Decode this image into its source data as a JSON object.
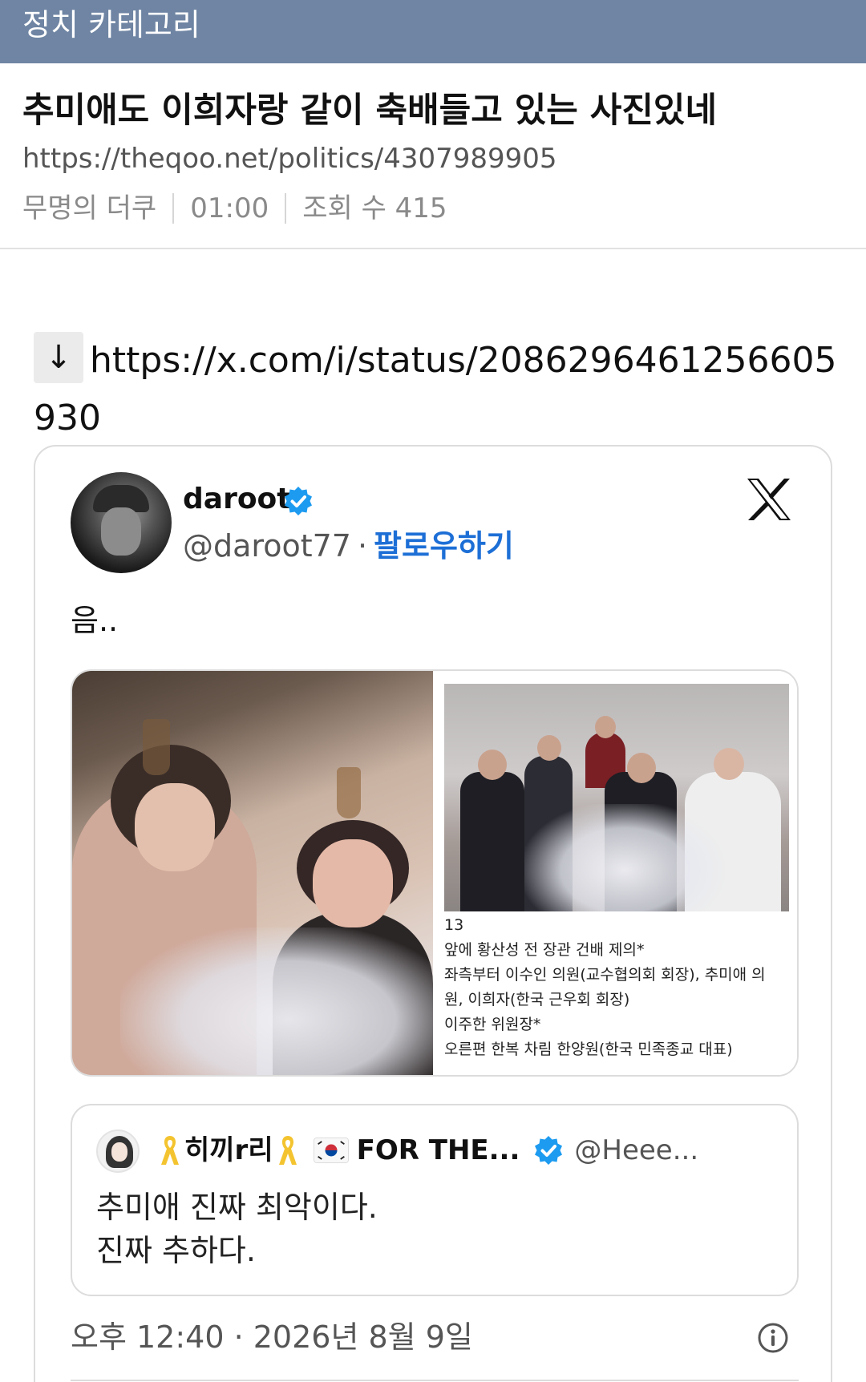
{
  "header": {
    "category": "정치 카테고리",
    "accent_color": "#6f85a3"
  },
  "post": {
    "title": "추미애도 이희자랑 같이 축배들고 있는 사진있네",
    "url": "https://theqoo.net/politics/4307989905",
    "author": "무명의 더쿠",
    "time": "01:00",
    "views": "조회 수 415"
  },
  "body": {
    "arrow": "↓",
    "link": "https://x.com/i/status/2086296461256605930"
  },
  "tweet": {
    "display_name": "daroot",
    "handle": "@daroot77",
    "separator": "·",
    "follow_label": "팔로우하기",
    "text": "음..",
    "caption_lines": [
      "13",
      "앞에 황산성 전 장관 건배 제의*",
      "좌측부터 이수인 의원(교수협의회 회장), 추미애 의",
      "원, 이희자(한국 근우회 회장)",
      "이주한 위원장*",
      "오른편 한복 차림 한양원(한국 민족종교 대표)"
    ],
    "quote": {
      "name": "히끼r리",
      "name_suffix": "FOR THE...",
      "handle": "@Heee...",
      "lines": [
        "추미애 진짜 최악이다.",
        "진짜 추하다."
      ]
    },
    "timestamp": "오후 12:40 · 2026년 8월 9일",
    "icons": {
      "verified": "verified-badge-icon",
      "platform": "x-logo-icon",
      "info": "info-icon",
      "ribbon": "yellow-ribbon-icon",
      "flag": "korea-flag-icon"
    },
    "colors": {
      "link": "#1d6fd6",
      "verified": "#1d9bf0",
      "ribbon": "#f4c430"
    }
  }
}
